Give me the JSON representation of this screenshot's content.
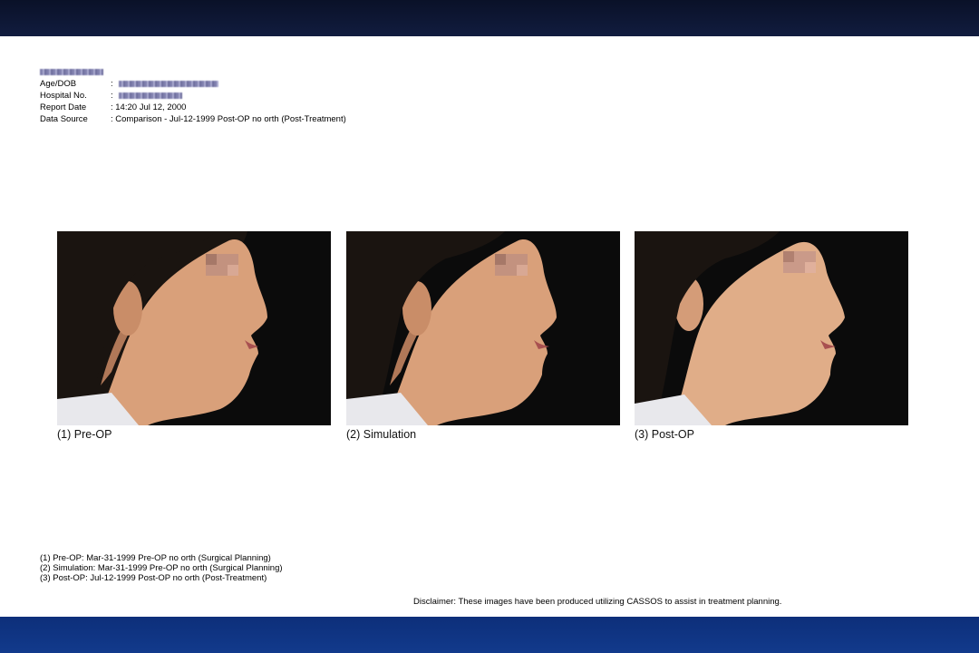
{
  "report": {
    "age_dob_label": "Age/DOB",
    "hospital_label": "Hospital No.",
    "report_date_label": "Report Date",
    "report_date_value": ": 14:20 Jul 12, 2000",
    "data_source_label": "Data Source",
    "data_source_value": ": Comparison - Jul-12-1999 Post-OP no orth (Post-Treatment)",
    "colon": ":"
  },
  "photos": [
    {
      "caption": "(1) Pre-OP"
    },
    {
      "caption": "(2) Simulation"
    },
    {
      "caption": "(3) Post-OP"
    }
  ],
  "notes": [
    "(1) Pre-OP:  Mar-31-1999 Pre-OP no orth (Surgical Planning)",
    "(2) Simulation:  Mar-31-1999 Pre-OP no orth (Surgical Planning)",
    "(3) Post-OP:  Jul-12-1999 Post-OP no orth (Post-Treatment)"
  ],
  "disclaimer": "Disclaimer: These images have been produced utilizing CASSOS to assist in treatment planning.",
  "colors": {
    "top_bar": "#0a1128",
    "bottom_bar": "#123a8c",
    "photo_background": "#0b0b0b",
    "skin": "#d9a07a",
    "hair": "#1a1410"
  }
}
